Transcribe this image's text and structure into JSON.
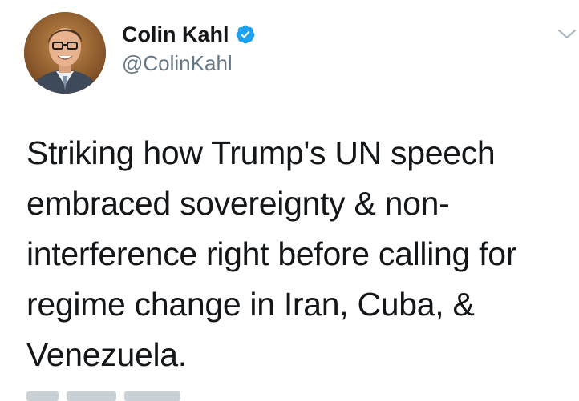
{
  "author": {
    "display_name": "Colin Kahl",
    "handle": "@ColinKahl",
    "verified": true
  },
  "tweet": {
    "text_lines": [
      "Striking how Trump's UN speech",
      "embraced sovereignty & non-",
      "interference right before calling for",
      "regime change in Iran, Cuba, &",
      "Venezuela."
    ]
  },
  "icons": {
    "verified": "verified-badge-icon",
    "menu": "chevron-down-icon"
  },
  "colors": {
    "text": "#14171a",
    "secondary_text": "#657786",
    "verified_blue": "#1da1f2",
    "background": "#ffffff"
  }
}
